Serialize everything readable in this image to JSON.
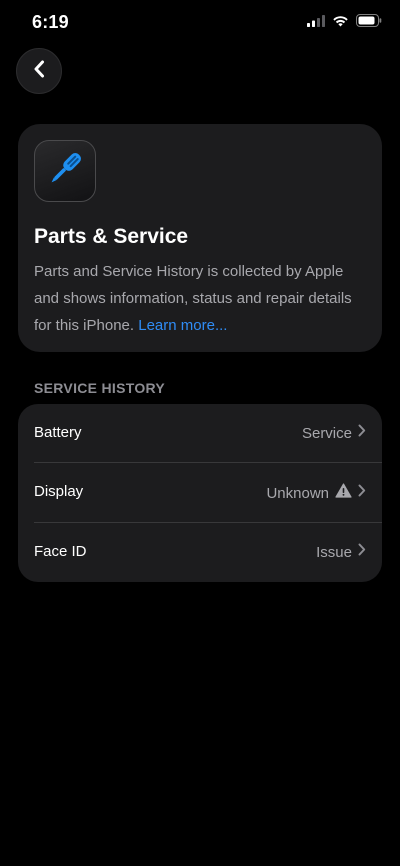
{
  "status_bar": {
    "time": "6:19"
  },
  "colors": {
    "background": "#000000",
    "card": "#1c1c1e",
    "link": "#2f8cf5",
    "secondary_text": "#a8a8ad",
    "icon_accent": "#1e8ff0"
  },
  "card": {
    "icon": "screwdriver-icon",
    "title": "Parts & Service",
    "description": "Parts and Service History is collected by Apple and shows information, status and repair details for this iPhone.",
    "learn_more": "Learn more..."
  },
  "service_history": {
    "header": "SERVICE HISTORY",
    "items": [
      {
        "label": "Battery",
        "value": "Service"
      },
      {
        "label": "Display",
        "value": "Unknown",
        "icon": "warning-icon"
      },
      {
        "label": "Face ID",
        "value": "Issue"
      }
    ]
  }
}
